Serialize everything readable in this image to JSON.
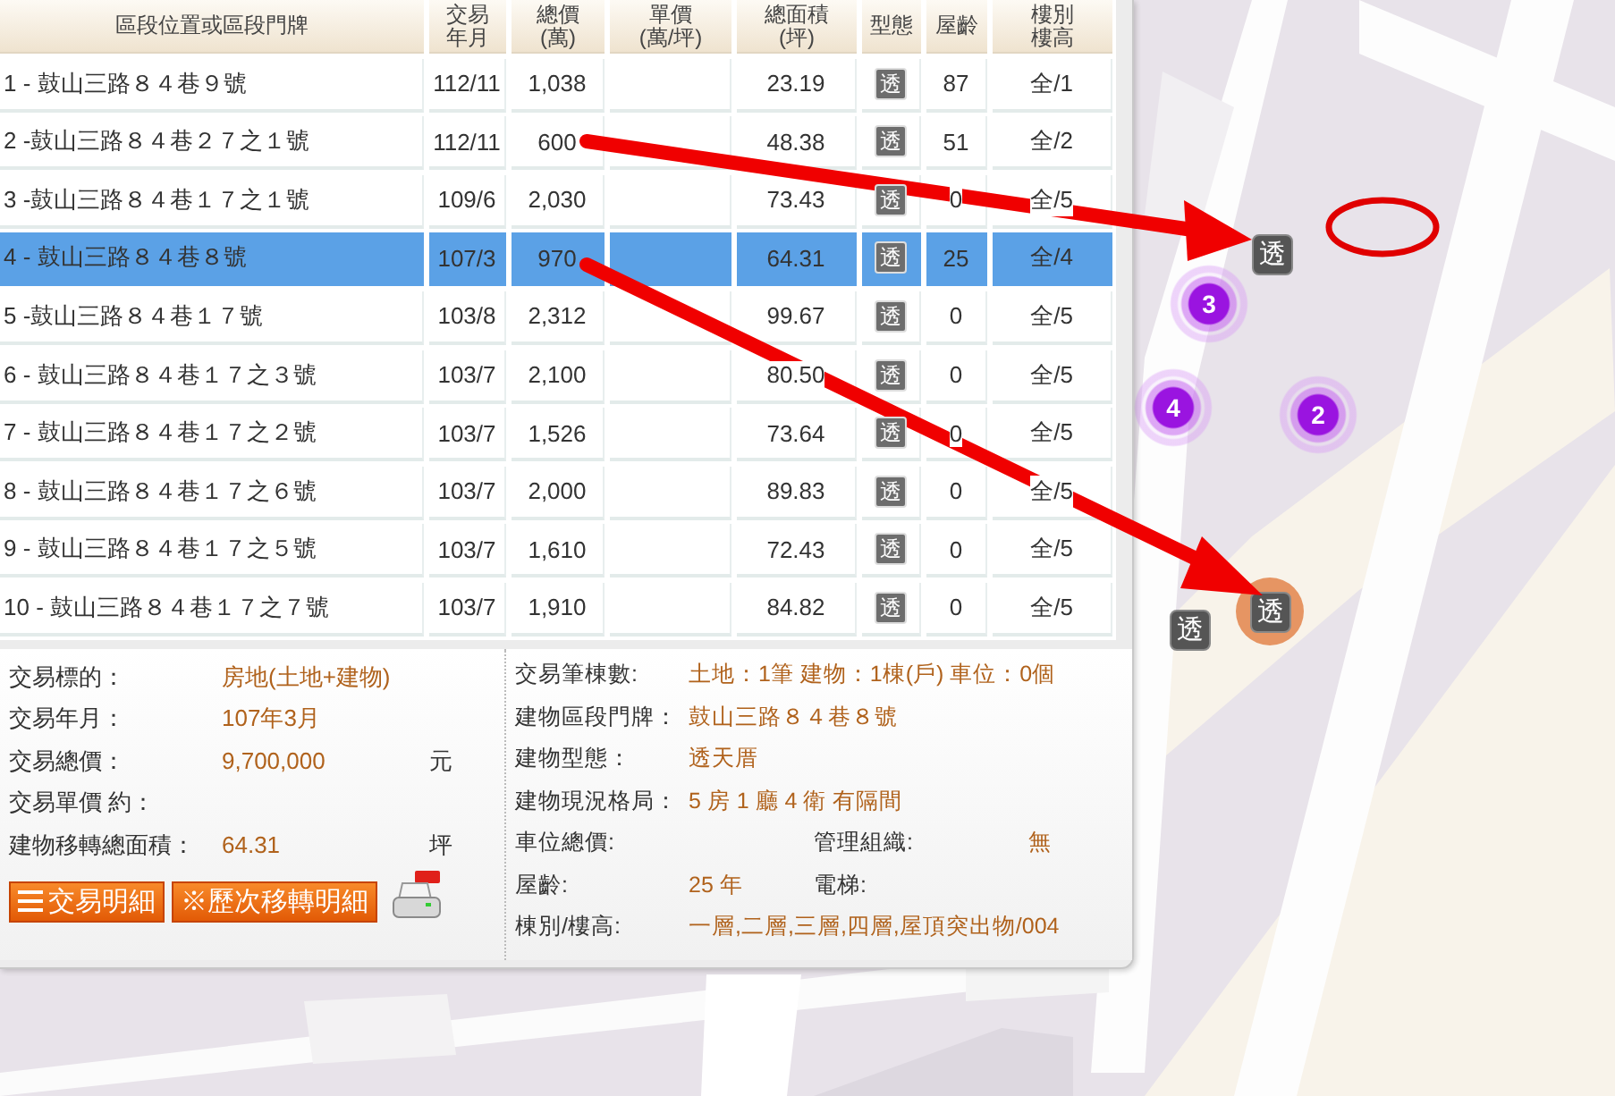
{
  "table": {
    "columns": [
      {
        "lines": [
          "區段位置或區段門牌"
        ]
      },
      {
        "lines": [
          "交易",
          "年月"
        ]
      },
      {
        "lines": [
          "總價",
          "(萬)"
        ]
      },
      {
        "lines": [
          "單價",
          "(萬/坪)"
        ]
      },
      {
        "lines": [
          "總面積",
          "(坪)"
        ]
      },
      {
        "lines": [
          "型態"
        ]
      },
      {
        "lines": [
          "屋齡"
        ]
      },
      {
        "lines": [
          "樓別",
          "樓高"
        ]
      }
    ],
    "rows": [
      {
        "address": "1 - 鼓山三路８４巷９號",
        "date": "112/11",
        "total": "1,038",
        "area": "23.19",
        "type": "透",
        "age": "87",
        "floor": "全/1",
        "selected": false
      },
      {
        "address": "2 -鼓山三路８４巷２７之１號",
        "date": "112/11",
        "total": "600",
        "area": "48.38",
        "type": "透",
        "age": "51",
        "floor": "全/2",
        "selected": false
      },
      {
        "address": "3 -鼓山三路８４巷１７之１號",
        "date": "109/6",
        "total": "2,030",
        "area": "73.43",
        "type": "透",
        "age": "0",
        "floor": "全/5",
        "selected": false
      },
      {
        "address": "4 - 鼓山三路８４巷８號",
        "date": "107/3",
        "total": "970",
        "area": "64.31",
        "type": "透",
        "age": "25",
        "floor": "全/4",
        "selected": true
      },
      {
        "address": "5 -鼓山三路８４巷１７號",
        "date": "103/8",
        "total": "2,312",
        "area": "99.67",
        "type": "透",
        "age": "0",
        "floor": "全/5",
        "selected": false
      },
      {
        "address": "6 - 鼓山三路８４巷１７之３號",
        "date": "103/7",
        "total": "2,100",
        "area": "80.50",
        "type": "透",
        "age": "0",
        "floor": "全/5",
        "selected": false
      },
      {
        "address": "7 - 鼓山三路８４巷１７之２號",
        "date": "103/7",
        "total": "1,526",
        "area": "73.64",
        "type": "透",
        "age": "0",
        "floor": "全/5",
        "selected": false
      },
      {
        "address": "8 - 鼓山三路８４巷１７之６號",
        "date": "103/7",
        "total": "2,000",
        "area": "89.83",
        "type": "透",
        "age": "0",
        "floor": "全/5",
        "selected": false
      },
      {
        "address": "9 - 鼓山三路８４巷１７之５號",
        "date": "103/7",
        "total": "1,610",
        "area": "72.43",
        "type": "透",
        "age": "0",
        "floor": "全/5",
        "selected": false
      },
      {
        "address": "10 - 鼓山三路８４巷１７之７號",
        "date": "103/7",
        "total": "1,910",
        "area": "84.82",
        "type": "透",
        "age": "0",
        "floor": "全/5",
        "selected": false
      }
    ]
  },
  "details": {
    "left": [
      {
        "label": "交易標的：",
        "value": "房地(土地+建物)"
      },
      {
        "label": "交易年月：",
        "value": "107年3月"
      },
      {
        "label": "交易總價：",
        "value": "9,700,000",
        "unit": "元"
      },
      {
        "label": "交易單價 約："
      },
      {
        "label": "建物移轉總面積：",
        "value": "64.31",
        "unit": "坪"
      }
    ],
    "right": [
      {
        "pairs": [
          {
            "label": "交易筆棟數:",
            "value": "土地：1筆 建物：1棟(戶) 車位：0個"
          }
        ]
      },
      {
        "pairs": [
          {
            "label": "建物區段門牌：",
            "value": "鼓山三路８４巷８號"
          }
        ]
      },
      {
        "pairs": [
          {
            "label": "建物型態：",
            "value": "透天厝"
          }
        ]
      },
      {
        "pairs": [
          {
            "label": "建物現況格局：",
            "value": "5 房 1 廳 4 衛 有隔間"
          }
        ]
      },
      {
        "pairs": [
          {
            "label": "車位總價:"
          },
          {
            "label": "管理組織:",
            "value": "無"
          }
        ]
      },
      {
        "pairs": [
          {
            "label": "屋齡:",
            "value": "25  年"
          },
          {
            "label": "電梯:"
          }
        ]
      },
      {
        "pairs": [
          {
            "label": "棟別/樓高:",
            "value": "一層,二層,三層,四層,屋頂突出物/004"
          }
        ]
      }
    ],
    "buttons": [
      {
        "kind": "menu",
        "label": "交易明細"
      },
      {
        "kind": "plain",
        "label": "※歷次移轉明細"
      },
      {
        "kind": "pdf"
      }
    ]
  },
  "map": {
    "markers": [
      {
        "kind": "building",
        "label": "透",
        "highlighted": false
      },
      {
        "kind": "cluster",
        "label": "3"
      },
      {
        "kind": "cluster",
        "label": "4"
      },
      {
        "kind": "cluster",
        "label": "2"
      },
      {
        "kind": "building",
        "label": "透",
        "highlighted": true
      },
      {
        "kind": "building",
        "label": "透",
        "highlighted": false
      }
    ]
  }
}
